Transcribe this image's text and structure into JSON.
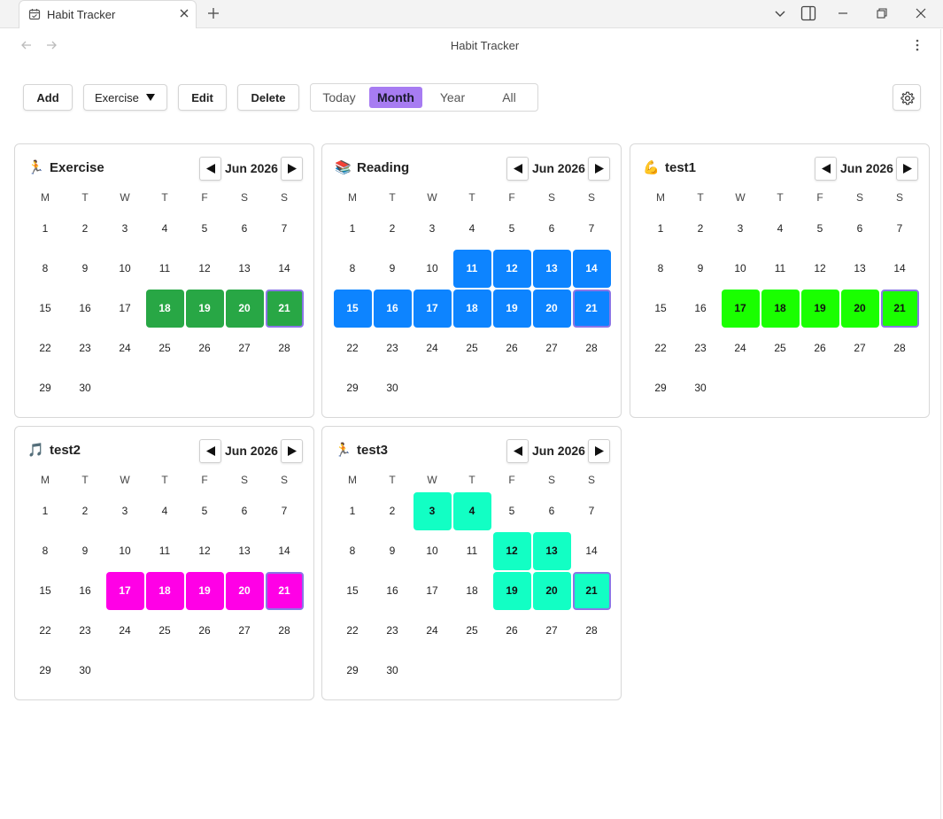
{
  "window": {
    "tab_title": "Habit Tracker",
    "page_title": "Habit Tracker"
  },
  "toolbar": {
    "add_label": "Add",
    "habit_select": "Exercise",
    "edit_label": "Edit",
    "delete_label": "Delete",
    "views": [
      "Today",
      "Month",
      "Year",
      "All"
    ],
    "active_view": "Month"
  },
  "dow_labels": [
    "M",
    "T",
    "W",
    "T",
    "F",
    "S",
    "S"
  ],
  "month_label": "Jun 2026",
  "first_weekday_index": 0,
  "days_in_month": 30,
  "today": 21,
  "accent_today_border": "#8a75e6",
  "habits": [
    {
      "name": "Exercise",
      "icon": "runner-icon",
      "glyph": "🏃",
      "color": "#28a745",
      "text_color": "#ffffff",
      "done": [
        18,
        19,
        20,
        21
      ]
    },
    {
      "name": "Reading",
      "icon": "books-icon",
      "glyph": "📚",
      "color": "#0d84ff",
      "text_color": "#ffffff",
      "done": [
        11,
        12,
        13,
        14,
        15,
        16,
        17,
        18,
        19,
        20,
        21
      ]
    },
    {
      "name": "test1",
      "icon": "flexed-biceps-icon",
      "glyph": "💪",
      "color": "#1aff00",
      "text_color": "#111111",
      "done": [
        17,
        18,
        19,
        20,
        21
      ]
    },
    {
      "name": "test2",
      "icon": "music-note-icon",
      "glyph": "🎵",
      "color": "#ff00e6",
      "text_color": "#ffffff",
      "done": [
        17,
        18,
        19,
        20,
        21
      ]
    },
    {
      "name": "test3",
      "icon": "runner-icon",
      "glyph": "🏃",
      "color": "#12ffc4",
      "text_color": "#111111",
      "done": [
        3,
        4,
        12,
        13,
        19,
        20,
        21
      ]
    }
  ]
}
